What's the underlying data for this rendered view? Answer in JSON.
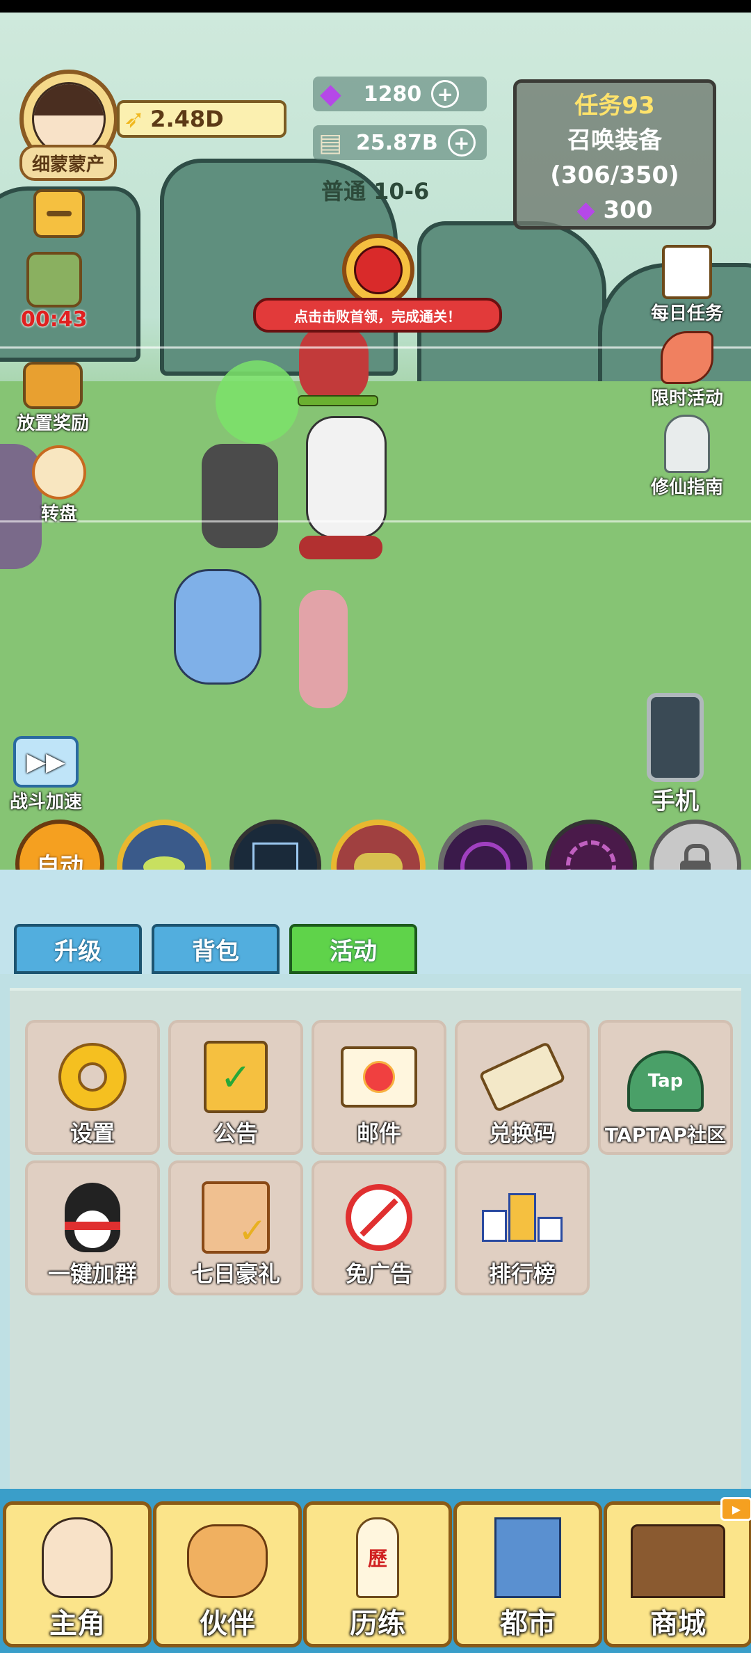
{
  "player": {
    "nickname": "细蒙蒙产",
    "gold": "2.48D"
  },
  "resources": {
    "gems": "1280",
    "cash": "25.87B"
  },
  "stage": "普通 10-6",
  "task": {
    "title": "任务93",
    "name": "召唤装备",
    "progress": "(306/350)",
    "reward": "300"
  },
  "left_buttons": {
    "timer": "00:43",
    "idle_reward": "放置奖励",
    "wheel": "转盘",
    "battle_speed": "战斗加速"
  },
  "right_buttons": {
    "daily_task": "每日任务",
    "limited_event": "限时活动",
    "guide": "修仙指南",
    "phone": "手机"
  },
  "boss_tip": "点击击败首领，完成通关！",
  "skills": {
    "auto": "自动"
  },
  "tabs": [
    {
      "label": "升级"
    },
    {
      "label": "背包"
    },
    {
      "label": "活动"
    }
  ],
  "activities": [
    {
      "label": "设置"
    },
    {
      "label": "公告"
    },
    {
      "label": "邮件"
    },
    {
      "label": "兑换码"
    },
    {
      "label": "TAPTAP社区"
    },
    {
      "label": "一键加群"
    },
    {
      "label": "七日豪礼"
    },
    {
      "label": "免广告"
    },
    {
      "label": "排行榜"
    }
  ],
  "nav": [
    {
      "label": "主角"
    },
    {
      "label": "伙伴"
    },
    {
      "label": "历练"
    },
    {
      "label": "都市"
    },
    {
      "label": "商城"
    }
  ],
  "colors": {
    "active_tab": "#5fd34a",
    "tab": "#52aede",
    "accent_gold": "#f5c040"
  }
}
